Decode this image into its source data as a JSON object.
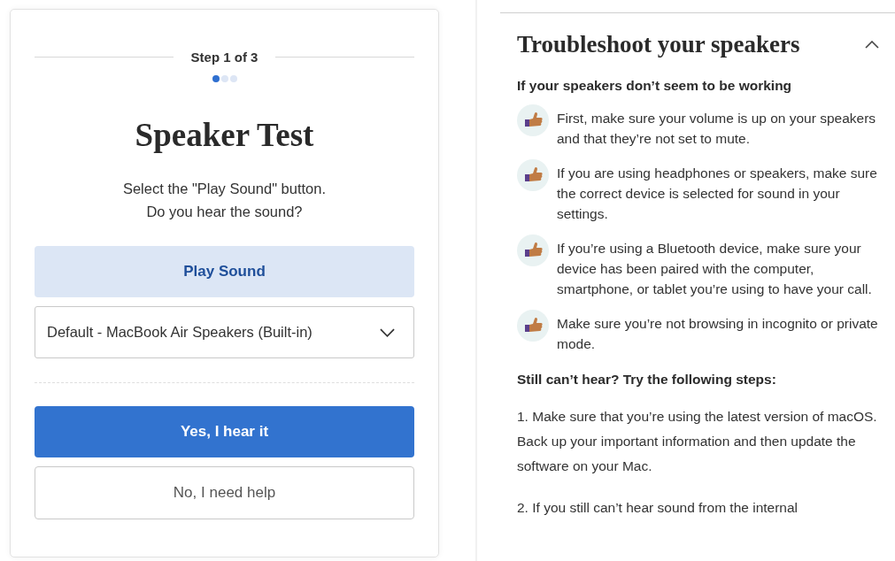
{
  "test_card": {
    "step_label": "Step 1 of 3",
    "steps": [
      {
        "selected": true
      },
      {
        "selected": false
      },
      {
        "selected": false
      }
    ],
    "title": "Speaker Test",
    "instructions": [
      "Select the \"Play Sound\" button.",
      "Do you hear the sound?"
    ],
    "play_button": "Play Sound",
    "device_select": {
      "value": "Default - MacBook Air Speakers (Built-in)"
    },
    "yes_button": "Yes, I hear it",
    "no_button": "No, I need help"
  },
  "troubleshoot": {
    "title": "Troubleshoot your speakers",
    "expanded": true,
    "subheading": "If your speakers don’t seem to be working",
    "tips": [
      "First, make sure your volume is up on your speakers and that they’re not set to mute.",
      "If you are using headphones or speakers, make sure the correct device is selected for sound in your settings.",
      "If you’re using a Bluetooth device, make sure your device has been paired with the computer, smartphone, or tablet you’re using to have your call.",
      "Make sure you’re not browsing in incognito or private mode."
    ],
    "steps_heading": "Still can’t hear? Try the following steps:",
    "steps": [
      "1. Make sure that you’re using the latest version of macOS. Back up your important information and then update the software on your Mac.",
      "2. If you still can’t hear sound from the internal"
    ]
  }
}
